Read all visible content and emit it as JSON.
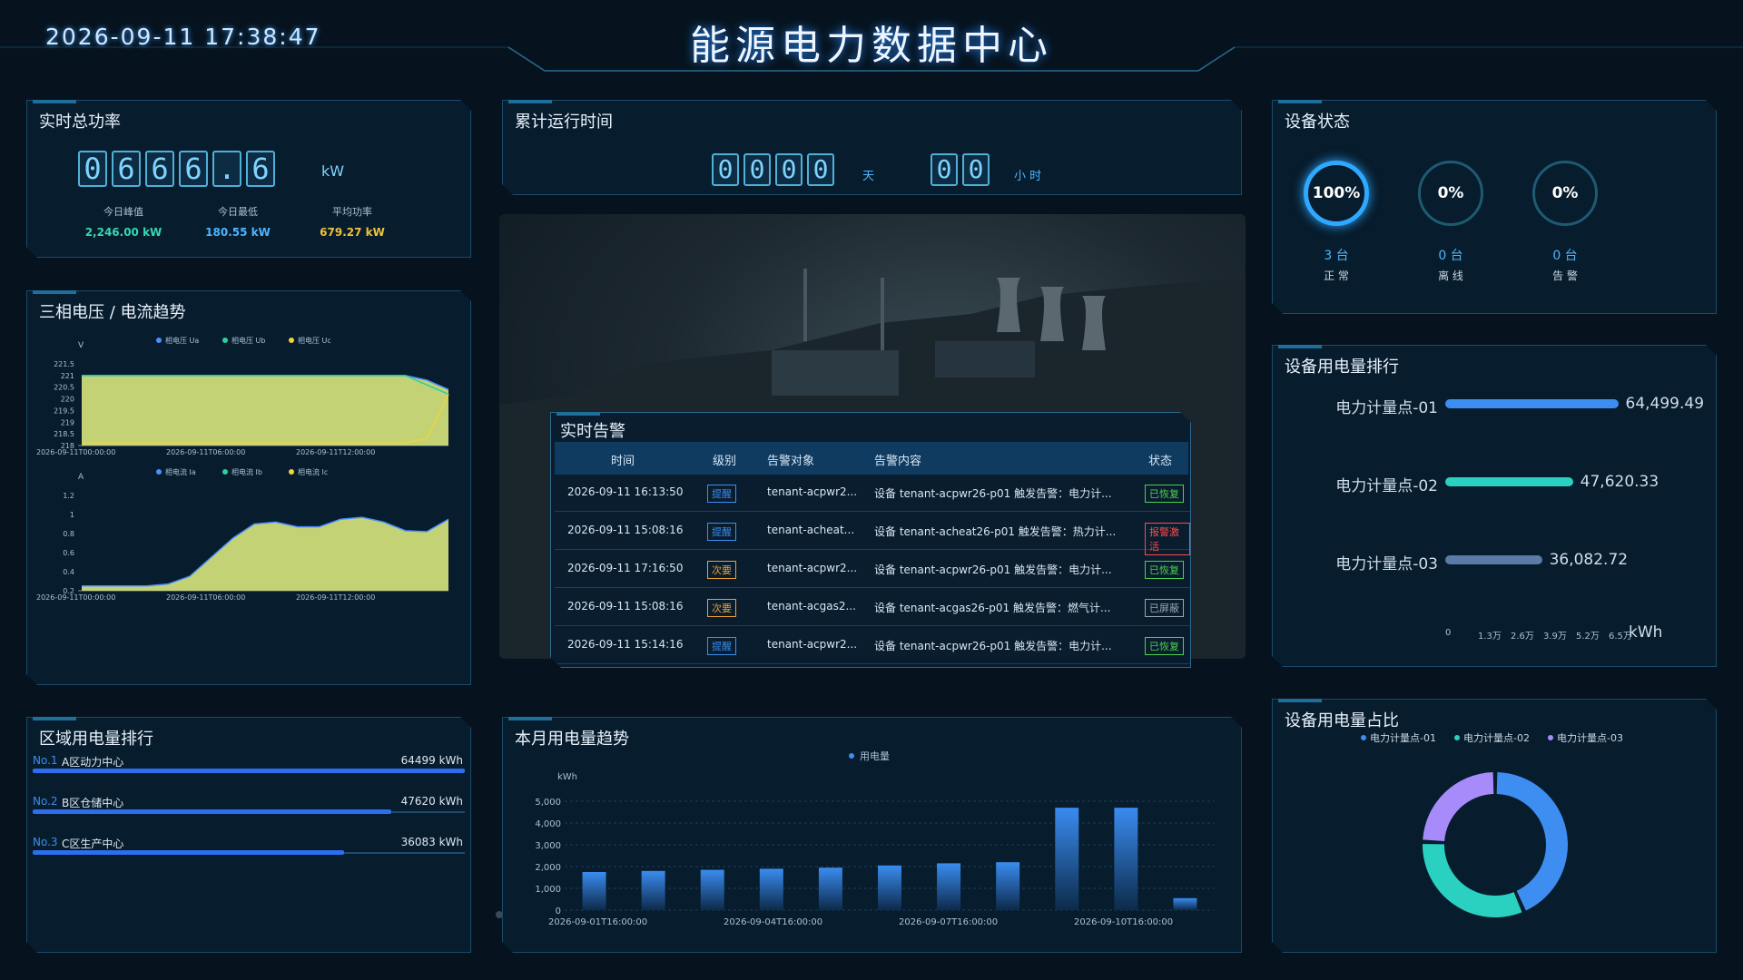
{
  "header": {
    "time": "2026-09-11 17:38:47",
    "title": "能源电力数据中心"
  },
  "power": {
    "title": "实时总功率",
    "digits": [
      "0",
      "6",
      "6",
      "6",
      ".",
      "6"
    ],
    "unit": "kW",
    "stats": [
      {
        "label": "今日峰值",
        "value": "2,246.00 kW",
        "color": "#38d6b4"
      },
      {
        "label": "今日最低",
        "value": "180.55 kW",
        "color": "#4cb6ff"
      },
      {
        "label": "平均功率",
        "value": "679.27 kW",
        "color": "#f0c23a"
      }
    ]
  },
  "runtime": {
    "title": "累计运行时间",
    "days": [
      "0",
      "0",
      "0",
      "0"
    ],
    "day_unit": "天",
    "hours": [
      "0",
      "0"
    ],
    "hour_unit": "小 时"
  },
  "device_status": {
    "title": "设备状态",
    "items": [
      {
        "pct": "100%",
        "count": "3 台",
        "label": "正 常"
      },
      {
        "pct": "0%",
        "count": "0 台",
        "label": "离 线"
      },
      {
        "pct": "0%",
        "count": "0 台",
        "label": "告 警"
      }
    ]
  },
  "trend": {
    "title": "三相电压 / 电流趋势",
    "voltage": {
      "unit": "V",
      "legend": [
        "相电压 Ua",
        "相电压 Ub",
        "相电压 Uc"
      ],
      "yticks": [
        "221.5",
        "221",
        "220.5",
        "220",
        "219.5",
        "219",
        "218.5",
        "218"
      ],
      "xticks": [
        "2026-09-11T00:00:00",
        "2026-09-11T06:00:00",
        "2026-09-11T12:00:00"
      ]
    },
    "current": {
      "unit": "A",
      "legend": [
        "相电流 Ia",
        "相电流 Ib",
        "相电流 Ic"
      ],
      "yticks": [
        "1.2",
        "1",
        "0.8",
        "0.6",
        "0.4",
        "0.2"
      ],
      "xticks": [
        "2026-09-11T00:00:00",
        "2026-09-11T06:00:00",
        "2026-09-11T12:00:00"
      ]
    }
  },
  "alarms": {
    "title": "实时告警",
    "headers": [
      "时间",
      "级别",
      "告警对象",
      "告警内容",
      "状态"
    ],
    "rows": [
      {
        "time": "2026-09-11 16:13:50",
        "level": "提醒",
        "obj": "tenant-acpwr2...",
        "content": "设备 tenant-acpwr26-p01 触发告警：电力计...",
        "status": "已恢复"
      },
      {
        "time": "2026-09-11 15:08:16",
        "level": "提醒",
        "obj": "tenant-acheat...",
        "content": "设备 tenant-acheat26-p01 触发告警：热力计...",
        "status": "报警激活"
      },
      {
        "time": "2026-09-11 17:16:50",
        "level": "次要",
        "obj": "tenant-acpwr2...",
        "content": "设备 tenant-acpwr26-p01 触发告警：电力计...",
        "status": "已恢复"
      },
      {
        "time": "2026-09-11 15:08:16",
        "level": "次要",
        "obj": "tenant-acgas2...",
        "content": "设备 tenant-acgas26-p01 触发告警：燃气计...",
        "status": "已屏蔽"
      },
      {
        "time": "2026-09-11 15:14:16",
        "level": "提醒",
        "obj": "tenant-acpwr2...",
        "content": "设备 tenant-acpwr26-p01 触发告警：电力计...",
        "status": "已恢复"
      }
    ]
  },
  "device_rank": {
    "title": "设备用电量排行",
    "unit": "kWh",
    "axis": [
      "0",
      "1.3万",
      "2.6万",
      "3.9万",
      "5.2万",
      "6.5万"
    ],
    "items": [
      {
        "name": "电力计量点-01",
        "value": 64499.49,
        "label": "64,499.49",
        "color": "#3d8ef0"
      },
      {
        "name": "电力计量点-02",
        "value": 47620.33,
        "label": "47,620.33",
        "color": "#2ad0c0"
      },
      {
        "name": "电力计量点-03",
        "value": 36082.72,
        "label": "36,082.72",
        "color": "#5b7aa6"
      }
    ]
  },
  "region_rank": {
    "title": "区域用电量排行",
    "items": [
      {
        "no": "No.1",
        "name": "A区动力中心",
        "value": "64499 kWh",
        "frac": 1.0
      },
      {
        "no": "No.2",
        "name": "B区仓储中心",
        "value": "47620 kWh",
        "frac": 0.83
      },
      {
        "no": "No.3",
        "name": "C区生产中心",
        "value": "36083 kWh",
        "frac": 0.72
      }
    ]
  },
  "monthly": {
    "title": "本月用电量趋势",
    "legend": "用电量",
    "unit": "kWh",
    "yticks": [
      "5,000",
      "4,000",
      "3,000",
      "2,000",
      "1,000",
      "0"
    ],
    "xticks": [
      "2026-09-01T16:00:00",
      "2026-09-04T16:00:00",
      "2026-09-07T16:00:00",
      "2026-09-10T16:00:00"
    ]
  },
  "share": {
    "title": "设备用电量占比",
    "legend": [
      "电力计量点-01",
      "电力计量点-02",
      "电力计量点-03"
    ]
  },
  "chart_data": [
    {
      "type": "bar",
      "title": "本月用电量趋势",
      "ylabel": "kWh",
      "ylim": [
        0,
        5000
      ],
      "x": [
        "2026-09-01",
        "2026-09-02",
        "2026-09-03",
        "2026-09-04",
        "2026-09-05",
        "2026-09-06",
        "2026-09-07",
        "2026-09-08",
        "2026-09-09",
        "2026-09-10",
        "2026-09-11"
      ],
      "series": [
        {
          "name": "用电量",
          "values": [
            1750,
            1800,
            1850,
            1900,
            1950,
            2050,
            2150,
            2200,
            4700,
            4700,
            550
          ]
        }
      ]
    },
    {
      "type": "pie",
      "title": "设备用电量占比",
      "categories": [
        "电力计量点-01",
        "电力计量点-02",
        "电力计量点-03"
      ],
      "values": [
        64499.49,
        47620.33,
        36082.72
      ],
      "colors": [
        "#3d8ef0",
        "#2ad0c0",
        "#a78bfa"
      ]
    },
    {
      "type": "area",
      "title": "三相电压",
      "ylabel": "V",
      "ylim": [
        218,
        221.5
      ],
      "x": [
        0,
        1,
        2,
        3,
        4,
        5,
        6,
        7,
        8,
        9,
        10,
        11,
        12,
        13,
        14,
        15,
        16,
        17
      ],
      "series": [
        {
          "name": "相电压 Ua",
          "values": [
            221,
            221,
            221,
            221,
            221,
            221,
            221,
            221,
            221,
            221,
            221,
            221,
            221,
            221,
            221,
            221,
            220.8,
            220.4
          ]
        },
        {
          "name": "相电压 Ub",
          "values": [
            221,
            221,
            221,
            221,
            221,
            221,
            221,
            221,
            221,
            221,
            221,
            221,
            221,
            221,
            221,
            221,
            220.6,
            220.2
          ]
        },
        {
          "name": "相电压 Uc",
          "values": [
            218.1,
            218.1,
            218.1,
            218.1,
            218.1,
            218.1,
            218.1,
            218.1,
            218.1,
            218.1,
            218.1,
            218.1,
            218.1,
            218.1,
            218.1,
            218.1,
            218.3,
            220.2
          ]
        }
      ]
    },
    {
      "type": "area",
      "title": "三相电流",
      "ylabel": "A",
      "ylim": [
        0.2,
        1.2
      ],
      "x": [
        0,
        1,
        2,
        3,
        4,
        5,
        6,
        7,
        8,
        9,
        10,
        11,
        12,
        13,
        14,
        15,
        16,
        17
      ],
      "series": [
        {
          "name": "相电流 Ia",
          "values": [
            0.25,
            0.25,
            0.25,
            0.25,
            0.27,
            0.35,
            0.55,
            0.75,
            0.9,
            0.92,
            0.87,
            0.87,
            0.95,
            0.97,
            0.92,
            0.83,
            0.82,
            0.95
          ]
        }
      ]
    }
  ]
}
